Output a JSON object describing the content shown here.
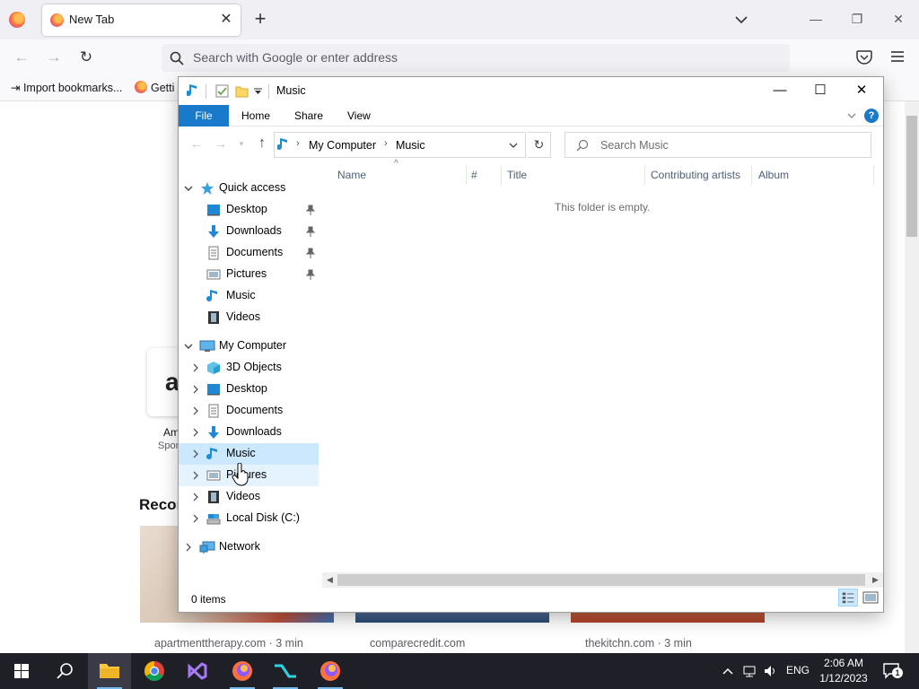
{
  "browser": {
    "tab_title": "New Tab",
    "url_placeholder": "Search with Google or enter address",
    "bookmarks": [
      {
        "label": "Import bookmarks..."
      },
      {
        "label": "Getti"
      }
    ],
    "ntp": {
      "tile_letter": "a",
      "tile_label": "Am",
      "tile_sub": "Spon",
      "recommend_heading": "Recon",
      "cards": [
        {
          "source": "apartmenttherapy.com · 3 min"
        },
        {
          "source": "comparecredit.com"
        },
        {
          "source": "thekitchn.com · 3 min"
        }
      ]
    }
  },
  "explorer": {
    "window_title": "Music",
    "ribbon": {
      "file": "File",
      "tabs": [
        "Home",
        "Share",
        "View"
      ],
      "help": "?"
    },
    "address": {
      "crumbs": [
        "My Computer",
        "Music"
      ]
    },
    "search_placeholder": "Search Music",
    "nav": {
      "quick_access": "Quick access",
      "quick_items": [
        "Desktop",
        "Downloads",
        "Documents",
        "Pictures",
        "Music",
        "Videos"
      ],
      "my_computer": "My Computer",
      "computer_items": [
        "3D Objects",
        "Desktop",
        "Documents",
        "Downloads",
        "Music",
        "Pictures",
        "Videos",
        "Local Disk (C:)"
      ],
      "network": "Network",
      "selected": "Music"
    },
    "columns": [
      "Name",
      "#",
      "Title",
      "Contributing artists",
      "Album"
    ],
    "empty_message": "This folder is empty.",
    "status": "0 items"
  },
  "taskbar": {
    "time": "2:06 AM",
    "date": "1/12/2023",
    "lang": "ENG",
    "notification_count": "1"
  },
  "colors": {
    "accent": "#1979ca",
    "selection": "#cce8ff",
    "taskbar": "#1f1f28"
  }
}
